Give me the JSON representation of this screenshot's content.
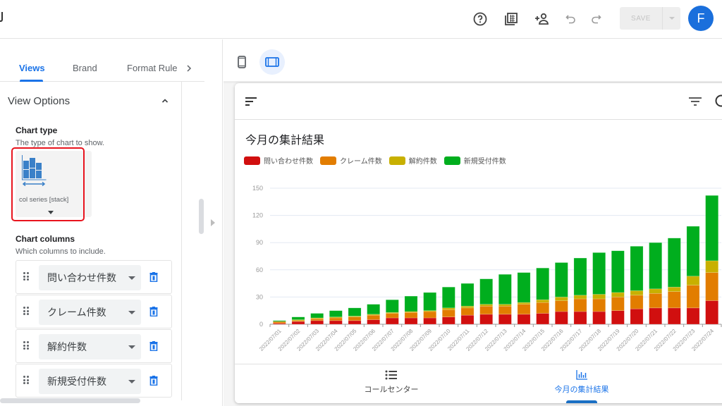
{
  "topbar": {
    "save_label": "SAVE",
    "avatar_initial": "F",
    "icons": [
      "help-icon",
      "grid-gallery-icon",
      "share-person-icon",
      "undo-icon",
      "redo-icon"
    ]
  },
  "editor": {
    "tabs": [
      {
        "label": "Views",
        "active": true
      },
      {
        "label": "Brand",
        "active": false
      },
      {
        "label": "Format Rule",
        "active": false
      }
    ],
    "section_title": "View Options",
    "chart_type": {
      "title": "Chart type",
      "subtitle": "The type of chart to show.",
      "value": "col series [stack]"
    },
    "chart_columns": {
      "title": "Chart columns",
      "subtitle": "Which columns to include.",
      "items": [
        "問い合わせ件数",
        "クレーム件数",
        "解約件数",
        "新規受付件数"
      ]
    }
  },
  "preview": {
    "devices": [
      {
        "name": "phone",
        "active": false
      },
      {
        "name": "tablet",
        "active": true
      }
    ],
    "nav": [
      {
        "label": "コールセンター",
        "icon": "list-icon",
        "active": false
      },
      {
        "label": "今月の集計結果",
        "icon": "bar-chart-icon",
        "active": true
      }
    ]
  },
  "colors": {
    "accent": "#1a73e8",
    "series": [
      "#d10f0f",
      "#e27d00",
      "#c8b000",
      "#00ae1e"
    ]
  },
  "chart_data": {
    "type": "bar",
    "stacked": true,
    "title": "今月の集計結果",
    "xlabel": "",
    "ylabel": "",
    "ylim": [
      0,
      150
    ],
    "yticks": [
      0,
      30,
      60,
      90,
      120,
      150
    ],
    "grid": true,
    "legend": "top-left",
    "categories": [
      "2022/07/01",
      "2022/07/02",
      "2022/07/03",
      "2022/07/04",
      "2022/07/05",
      "2022/07/06",
      "2022/07/07",
      "2022/07/08",
      "2022/07/09",
      "2022/07/10",
      "2022/07/11",
      "2022/07/12",
      "2022/07/13",
      "2022/07/14",
      "2022/07/15",
      "2022/07/16",
      "2022/07/17",
      "2022/07/18",
      "2022/07/19",
      "2022/07/20",
      "2022/07/21",
      "2022/07/22",
      "2022/07/23",
      "2022/07/24"
    ],
    "series": [
      {
        "name": "問い合わせ件数",
        "values": [
          1,
          3,
          4,
          4,
          4,
          5,
          7,
          7,
          7,
          8,
          10,
          11,
          11,
          11,
          12,
          14,
          14,
          14,
          15,
          17,
          18,
          18,
          18,
          26
        ]
      },
      {
        "name": "クレーム件数",
        "values": [
          2,
          1,
          2,
          3,
          4,
          5,
          5,
          6,
          7,
          8,
          8,
          9,
          9,
          11,
          12,
          12,
          14,
          14,
          15,
          15,
          16,
          18,
          25,
          31
        ]
      },
      {
        "name": "解約件数",
        "values": [
          0,
          1,
          1,
          1,
          1,
          1,
          1,
          1,
          1,
          2,
          2,
          2,
          2,
          2,
          3,
          4,
          4,
          5,
          5,
          5,
          5,
          5,
          10,
          13
        ]
      },
      {
        "name": "新規受付件数",
        "values": [
          1,
          3,
          5,
          7,
          9,
          11,
          14,
          17,
          20,
          23,
          25,
          28,
          33,
          33,
          35,
          38,
          41,
          46,
          46,
          49,
          51,
          54,
          55,
          72
        ]
      }
    ]
  }
}
